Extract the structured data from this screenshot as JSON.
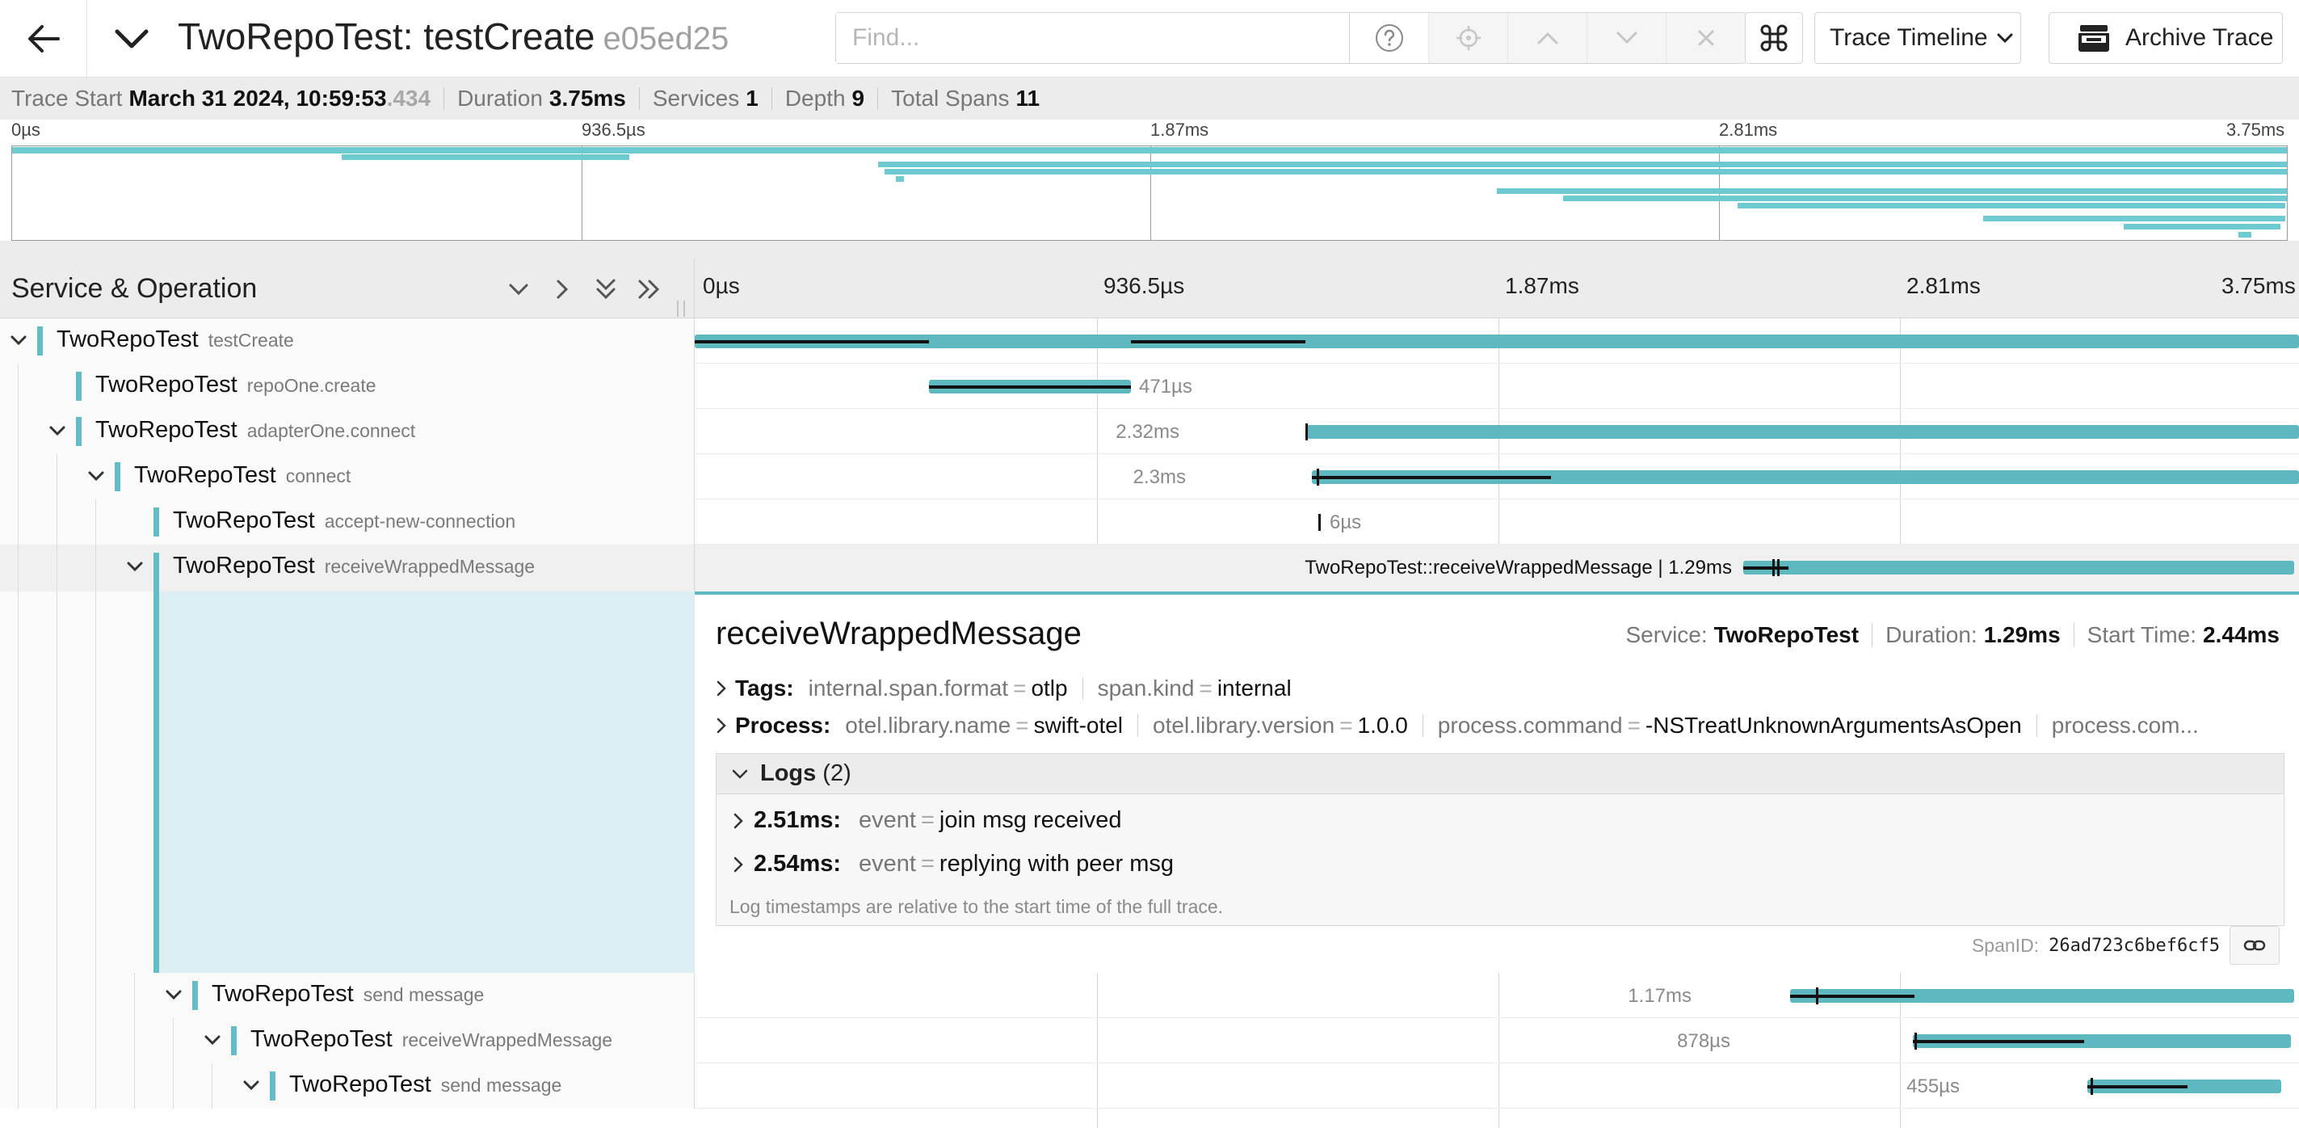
{
  "header": {
    "service": "TwoRepoTest",
    "operation": "testCreate",
    "title": "TwoRepoTest: testCreate",
    "trace_id_short": "e05ed25",
    "find_placeholder": "Find...",
    "view_select_label": "Trace Timeline",
    "archive_label": "Archive Trace"
  },
  "summary": {
    "trace_start_label": "Trace Start",
    "trace_start_value": "March 31 2024, 10:59:53",
    "trace_start_ms": ".434",
    "duration_label": "Duration",
    "duration_value": "3.75ms",
    "services_label": "Services",
    "services_value": "1",
    "depth_label": "Depth",
    "depth_value": "9",
    "total_spans_label": "Total Spans",
    "total_spans_value": "11"
  },
  "minimap": {
    "ticks": [
      "0µs",
      "936.5µs",
      "1.87ms",
      "2.81ms",
      "3.75ms"
    ]
  },
  "timeline": {
    "column_title": "Service & Operation",
    "ticks": [
      "0µs",
      "936.5µs",
      "1.87ms",
      "2.81ms",
      "3.75ms"
    ]
  },
  "spans": [
    {
      "service": "TwoRepoTest",
      "operation": "testCreate",
      "duration": ""
    },
    {
      "service": "TwoRepoTest",
      "operation": "repoOne.create",
      "duration": "471µs"
    },
    {
      "service": "TwoRepoTest",
      "operation": "adapterOne.connect",
      "duration": "2.32ms"
    },
    {
      "service": "TwoRepoTest",
      "operation": "connect",
      "duration": "2.3ms"
    },
    {
      "service": "TwoRepoTest",
      "operation": "accept-new-connection",
      "duration": "6µs"
    },
    {
      "service": "TwoRepoTest",
      "operation": "receiveWrappedMessage",
      "duration": "TwoRepoTest::receiveWrappedMessage | 1.29ms"
    },
    {
      "service": "TwoRepoTest",
      "operation": "send message",
      "duration": "1.17ms"
    },
    {
      "service": "TwoRepoTest",
      "operation": "receiveWrappedMessage",
      "duration": "878µs"
    },
    {
      "service": "TwoRepoTest",
      "operation": "send message",
      "duration": "455µs"
    }
  ],
  "detail": {
    "name": "receiveWrappedMessage",
    "service_label": "Service:",
    "service_value": "TwoRepoTest",
    "duration_label": "Duration:",
    "duration_value": "1.29ms",
    "start_label": "Start Time:",
    "start_value": "2.44ms",
    "tags_label": "Tags:",
    "tags": [
      {
        "key": "internal.span.format",
        "value": "otlp"
      },
      {
        "key": "span.kind",
        "value": "internal"
      }
    ],
    "process_label": "Process:",
    "process": [
      {
        "key": "otel.library.name",
        "value": "swift-otel"
      },
      {
        "key": "otel.library.version",
        "value": "1.0.0"
      },
      {
        "key": "process.command",
        "value": "-NSTreatUnknownArgumentsAsOpen"
      }
    ],
    "process_overflow": "process.com...",
    "logs_label": "Logs",
    "logs_count": "(2)",
    "logs": [
      {
        "time": "2.51ms:",
        "key": "event",
        "value": "join msg received"
      },
      {
        "time": "2.54ms:",
        "key": "event",
        "value": "replying with peer msg"
      }
    ],
    "logs_note": "Log timestamps are relative to the start time of the full trace.",
    "spanid_label": "SpanID:",
    "spanid_value": "26ad723c6bef6cf5"
  },
  "colors": {
    "span": "#5db8c0",
    "minimap_span": "#6ccad0",
    "service_marker": "#63bcc6"
  }
}
